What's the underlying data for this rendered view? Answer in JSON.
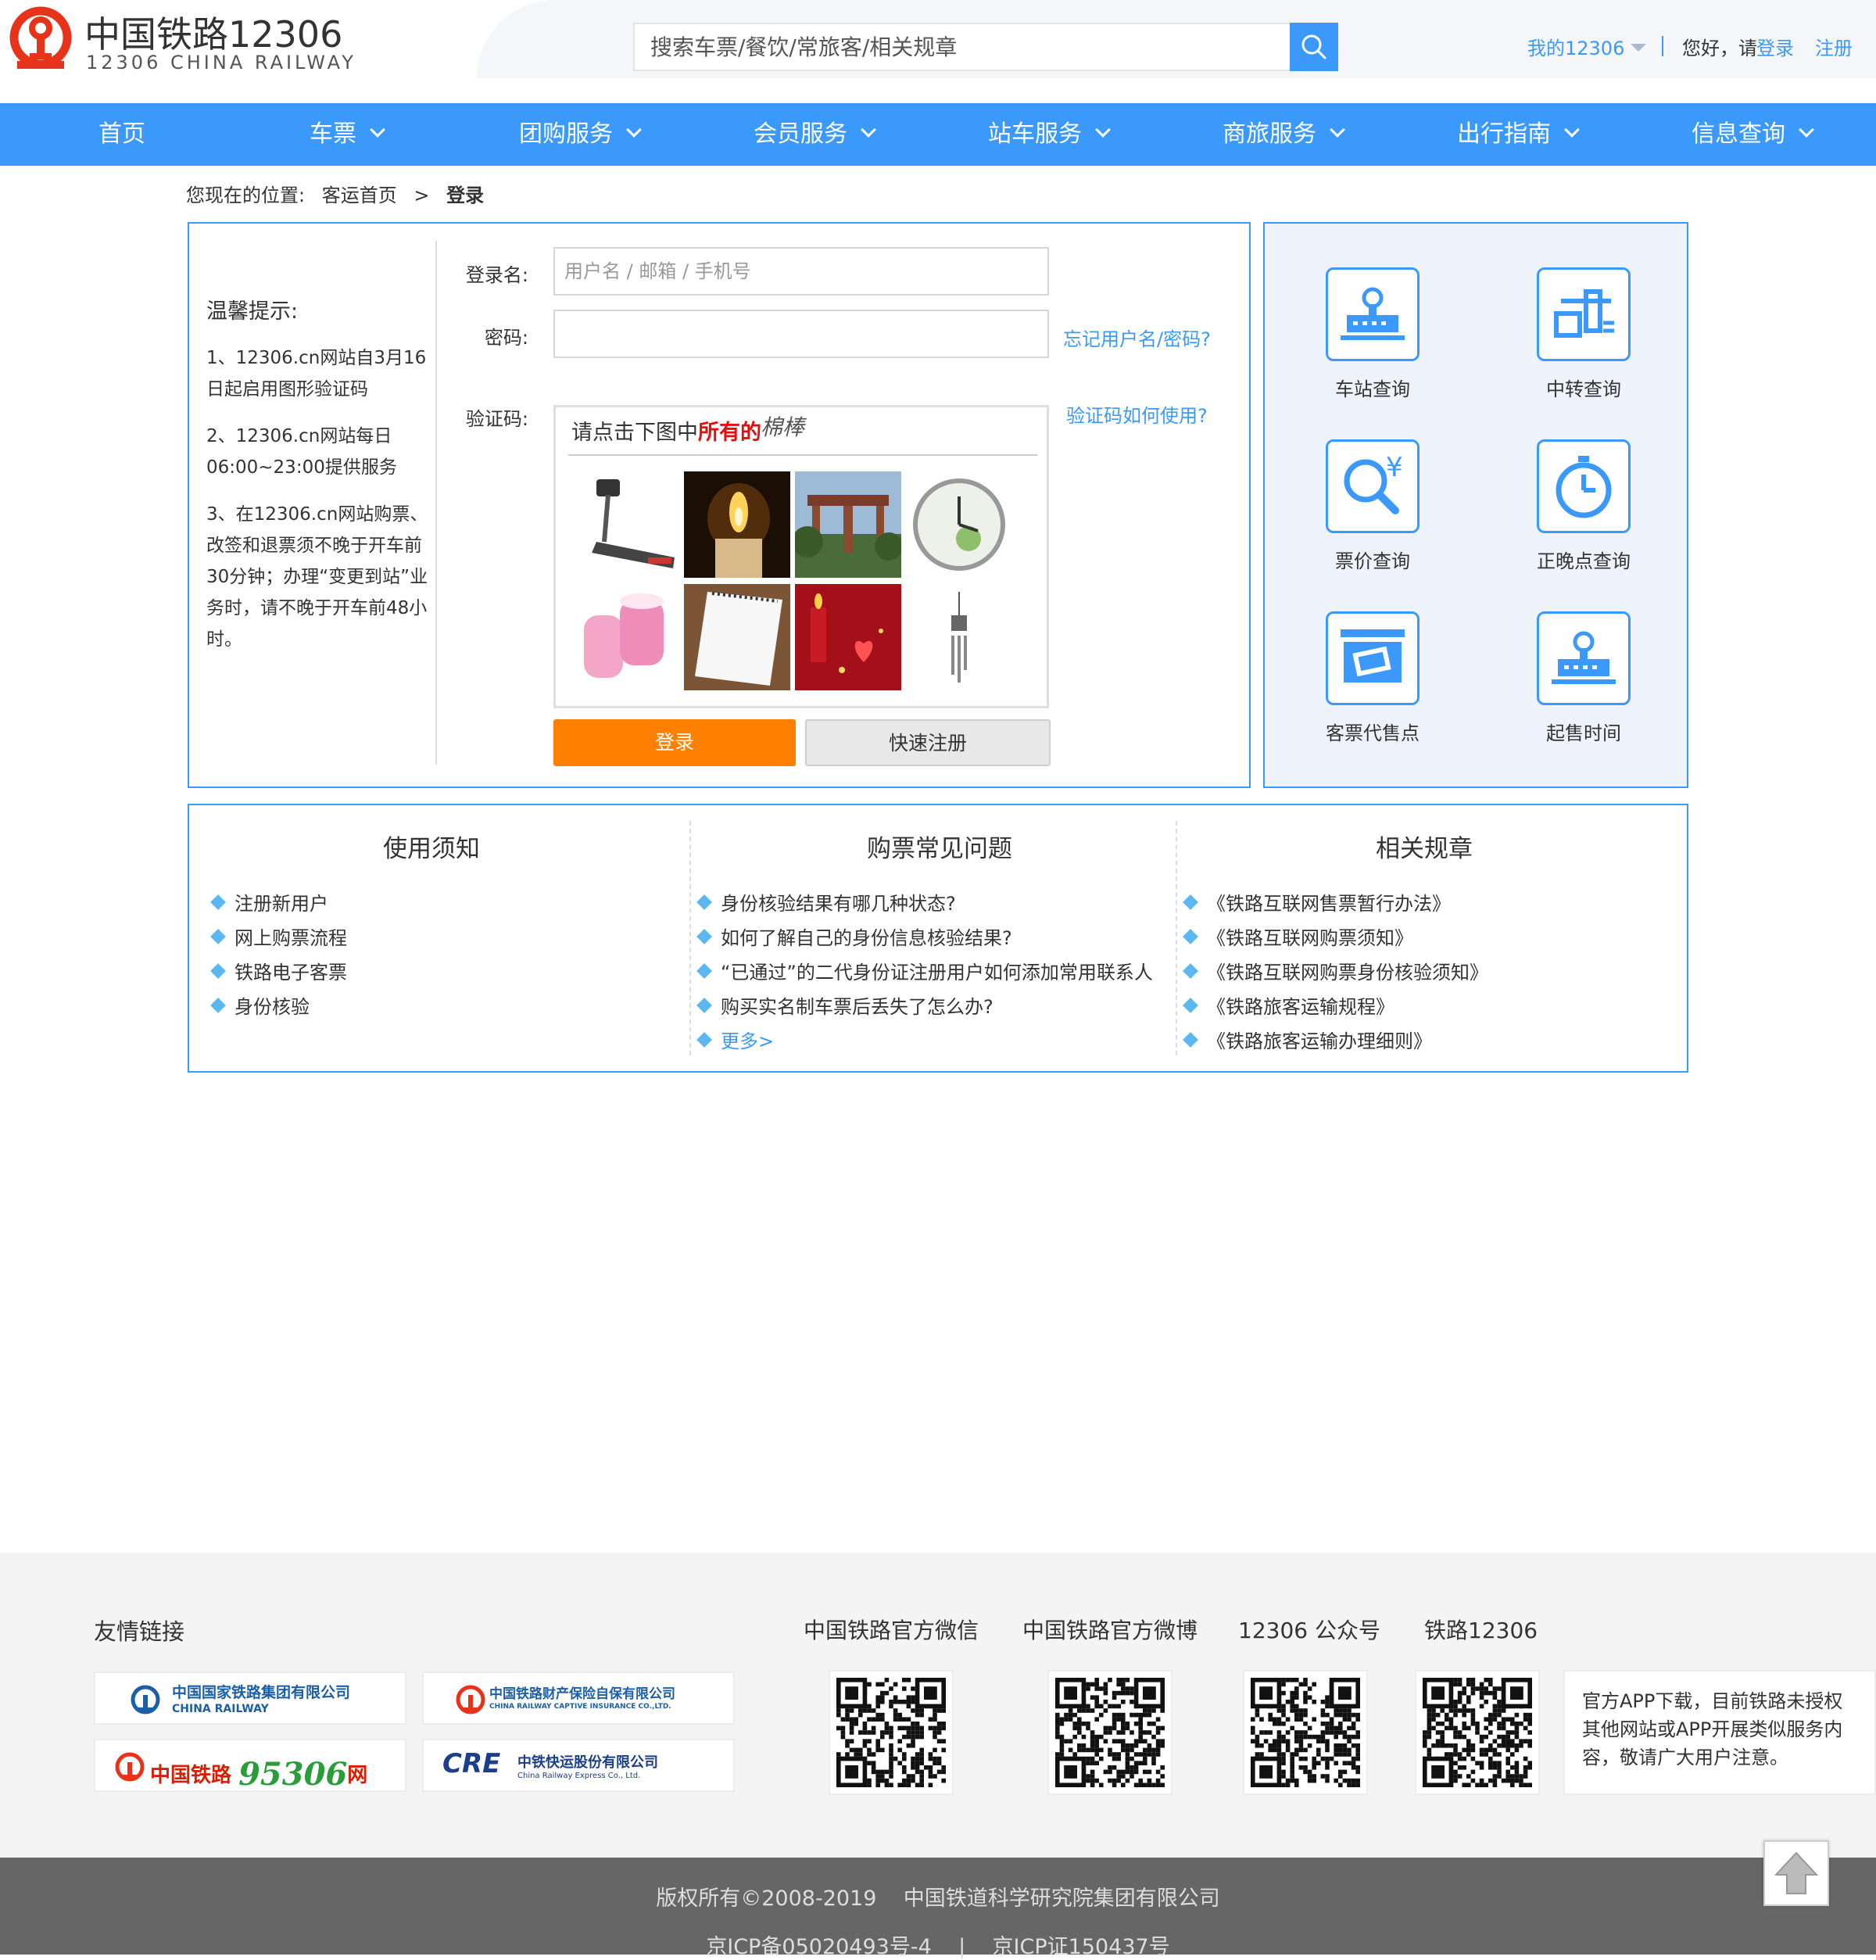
{
  "header": {
    "logo_title": "中国铁路12306",
    "logo_subtitle": "12306 CHINA RAILWAY",
    "search_placeholder": "搜索车票/餐饮/常旅客/相关规章",
    "my12306": "我的12306",
    "greeting": "您好，请",
    "login": "登录",
    "register": "注册"
  },
  "nav": {
    "items": [
      {
        "label": "首页"
      },
      {
        "label": "车票"
      },
      {
        "label": "团购服务"
      },
      {
        "label": "会员服务"
      },
      {
        "label": "站车服务"
      },
      {
        "label": "商旅服务"
      },
      {
        "label": "出行指南"
      },
      {
        "label": "信息查询"
      }
    ]
  },
  "breadcrumb": {
    "prefix": "您现在的位置:",
    "home": "客运首页",
    "separator": ">",
    "current": "登录"
  },
  "tips": {
    "title": "温馨提示:",
    "items": [
      "1、12306.cn网站自3月16日起启用图形验证码",
      "2、12306.cn网站每日06:00~23:00提供服务",
      "3、在12306.cn网站购票、改签和退票须不晚于开车前30分钟；办理“变更到站”业务时，请不晚于开车前48小时。"
    ]
  },
  "login_form": {
    "username_label": "登录名:",
    "username_placeholder": "用户名 / 邮箱 / 手机号",
    "password_label": "密码:",
    "forgot_link": "忘记用户名/密码?",
    "captcha_label": "验证码:",
    "captcha_help": "验证码如何使用?",
    "captcha_prompt_pre": "请点击下图中",
    "captcha_prompt_em": "所有的",
    "captcha_word": "棉棒",
    "login_button": "登录",
    "quick_register_button": "快速注册"
  },
  "services": [
    {
      "label": "车站查询",
      "icon": "station-icon"
    },
    {
      "label": "中转查询",
      "icon": "transfer-icon"
    },
    {
      "label": "票价查询",
      "icon": "fare-icon"
    },
    {
      "label": "正晚点查询",
      "icon": "clock-icon"
    },
    {
      "label": "客票代售点",
      "icon": "ticket-agency-icon"
    },
    {
      "label": "起售时间",
      "icon": "sale-time-icon"
    }
  ],
  "notices": {
    "columns": [
      {
        "title": "使用须知",
        "items": [
          "注册新用户",
          "网上购票流程",
          "铁路电子客票",
          "身份核验"
        ]
      },
      {
        "title": "购票常见问题",
        "items": [
          "身份核验结果有哪几种状态?",
          "如何了解自己的身份信息核验结果?",
          "“已通过”的二代身份证注册用户如何添加常用联系人",
          "购买实名制车票后丢失了怎么办?"
        ],
        "more": "更多>"
      },
      {
        "title": "相关规章",
        "items": [
          "《铁路互联网售票暂行办法》",
          "《铁路互联网购票须知》",
          "《铁路互联网购票身份核验须知》",
          "《铁路旅客运输规程》",
          "《铁路旅客运输办理细则》"
        ]
      }
    ]
  },
  "footer": {
    "friendly_links_title": "友情链接",
    "partners": [
      {
        "name": "中国国家铁路集团有限公司",
        "sub": "CHINA RAILWAY"
      },
      {
        "name": "中国铁路财产保险自保有限公司",
        "sub": "CHINA RAILWAY CAPTIVE INSURANCE CO.,LTD."
      },
      {
        "name": "中国铁路",
        "highlight": "95306",
        "suffix": "网"
      },
      {
        "name": "中铁快运股份有限公司",
        "brand": "CRE",
        "sub": "China Railway Express Co., Ltd."
      }
    ],
    "qr_titles": [
      "中国铁路官方微信",
      "中国铁路官方微博",
      "12306 公众号",
      "铁路12306"
    ],
    "app_note": "官方APP下载，目前铁路未授权其他网站或APP开展类似服务内容，敬请广大用户注意。",
    "copyright": "版权所有©2008-2019    中国铁道科学研究院集团有限公司",
    "icp": "京ICP备05020493号-4    |    京ICP证150437号"
  },
  "colors": {
    "brand_blue": "#3b99fc",
    "login_orange": "#ff8000",
    "logo_red": "#e8331b"
  }
}
